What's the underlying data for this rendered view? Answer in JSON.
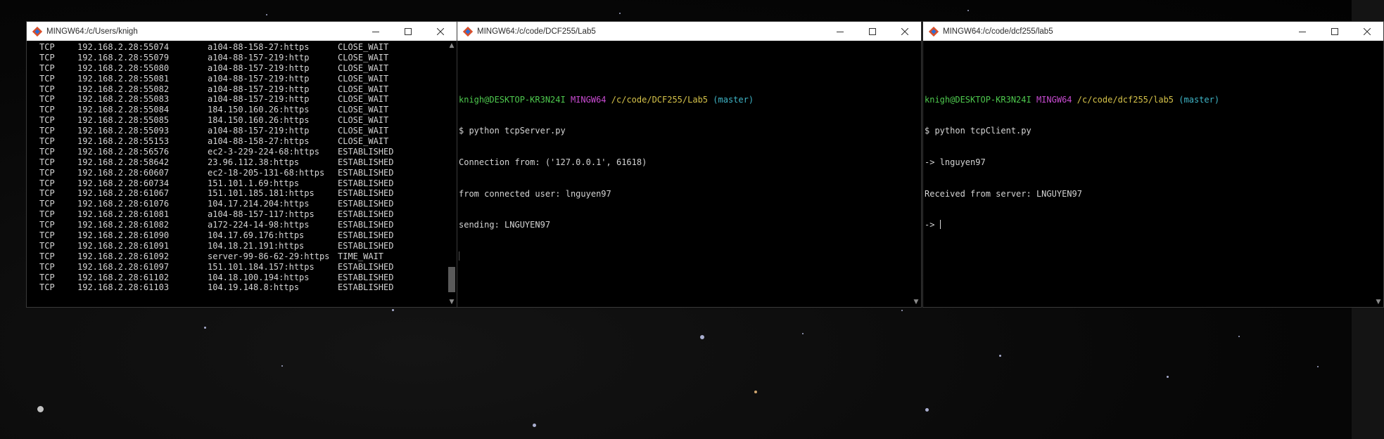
{
  "windows": [
    {
      "title": "MINGW64:/c/Users/knigh",
      "netstat_rows": [
        [
          "TCP",
          "192.168.2.28:55074",
          "a104-88-158-27:https",
          "CLOSE_WAIT"
        ],
        [
          "TCP",
          "192.168.2.28:55079",
          "a104-88-157-219:http",
          "CLOSE_WAIT"
        ],
        [
          "TCP",
          "192.168.2.28:55080",
          "a104-88-157-219:http",
          "CLOSE_WAIT"
        ],
        [
          "TCP",
          "192.168.2.28:55081",
          "a104-88-157-219:http",
          "CLOSE_WAIT"
        ],
        [
          "TCP",
          "192.168.2.28:55082",
          "a104-88-157-219:http",
          "CLOSE_WAIT"
        ],
        [
          "TCP",
          "192.168.2.28:55083",
          "a104-88-157-219:http",
          "CLOSE_WAIT"
        ],
        [
          "TCP",
          "192.168.2.28:55084",
          "184.150.160.26:https",
          "CLOSE_WAIT"
        ],
        [
          "TCP",
          "192.168.2.28:55085",
          "184.150.160.26:https",
          "CLOSE_WAIT"
        ],
        [
          "TCP",
          "192.168.2.28:55093",
          "a104-88-157-219:http",
          "CLOSE_WAIT"
        ],
        [
          "TCP",
          "192.168.2.28:55153",
          "a104-88-158-27:https",
          "CLOSE_WAIT"
        ],
        [
          "TCP",
          "192.168.2.28:56576",
          "ec2-3-229-224-68:https",
          "ESTABLISHED"
        ],
        [
          "TCP",
          "192.168.2.28:58642",
          "23.96.112.38:https",
          "ESTABLISHED"
        ],
        [
          "TCP",
          "192.168.2.28:60607",
          "ec2-18-205-131-68:https",
          "ESTABLISHED"
        ],
        [
          "TCP",
          "192.168.2.28:60734",
          "151.101.1.69:https",
          "ESTABLISHED"
        ],
        [
          "TCP",
          "192.168.2.28:61067",
          "151.101.185.181:https",
          "ESTABLISHED"
        ],
        [
          "TCP",
          "192.168.2.28:61076",
          "104.17.214.204:https",
          "ESTABLISHED"
        ],
        [
          "TCP",
          "192.168.2.28:61081",
          "a104-88-157-117:https",
          "ESTABLISHED"
        ],
        [
          "TCP",
          "192.168.2.28:61082",
          "a172-224-14-98:https",
          "ESTABLISHED"
        ],
        [
          "TCP",
          "192.168.2.28:61090",
          "104.17.69.176:https",
          "ESTABLISHED"
        ],
        [
          "TCP",
          "192.168.2.28:61091",
          "104.18.21.191:https",
          "ESTABLISHED"
        ],
        [
          "TCP",
          "192.168.2.28:61092",
          "server-99-86-62-29:https",
          "TIME_WAIT"
        ],
        [
          "TCP",
          "192.168.2.28:61097",
          "151.101.184.157:https",
          "ESTABLISHED"
        ],
        [
          "TCP",
          "192.168.2.28:61102",
          "104.18.100.194:https",
          "ESTABLISHED"
        ],
        [
          "TCP",
          "192.168.2.28:61103",
          "104.19.148.8:https",
          "ESTABLISHED"
        ]
      ]
    },
    {
      "title": "MINGW64:/c/code/DCF255/Lab5",
      "prompt_user": "knigh@DESKTOP-KR3N24I",
      "prompt_shell": "MINGW64",
      "prompt_path": "/c/code/DCF255/Lab5",
      "prompt_branch": "(master)",
      "command": "$ python tcpServer.py",
      "output": [
        "Connection from: ('127.0.0.1', 61618)",
        "from connected user: lnguyen97",
        "sending: LNGUYEN97"
      ]
    },
    {
      "title": "MINGW64:/c/code/dcf255/lab5",
      "prompt_user": "knigh@DESKTOP-KR3N24I",
      "prompt_shell": "MINGW64",
      "prompt_path": "/c/code/dcf255/lab5",
      "prompt_branch": "(master)",
      "command": "$ python tcpClient.py",
      "output": [
        "-> lnguyen97",
        "Received from server: LNGUYEN97"
      ],
      "input_prompt": "-> "
    }
  ],
  "icons": {
    "app": "git-bash-icon",
    "minimize": "minimize-icon",
    "maximize": "maximize-icon",
    "close": "close-icon",
    "scroll_up": "scroll-up-arrow-icon",
    "scroll_down": "scroll-down-arrow-icon"
  },
  "colors": {
    "prompt_user": "#4ec94e",
    "prompt_shell": "#c84bd1",
    "prompt_path": "#d6c34a",
    "prompt_branch": "#3fb5c7",
    "terminal_bg": "#000000",
    "terminal_fg": "#d4d4d4",
    "titlebar_bg": "#ffffff"
  }
}
